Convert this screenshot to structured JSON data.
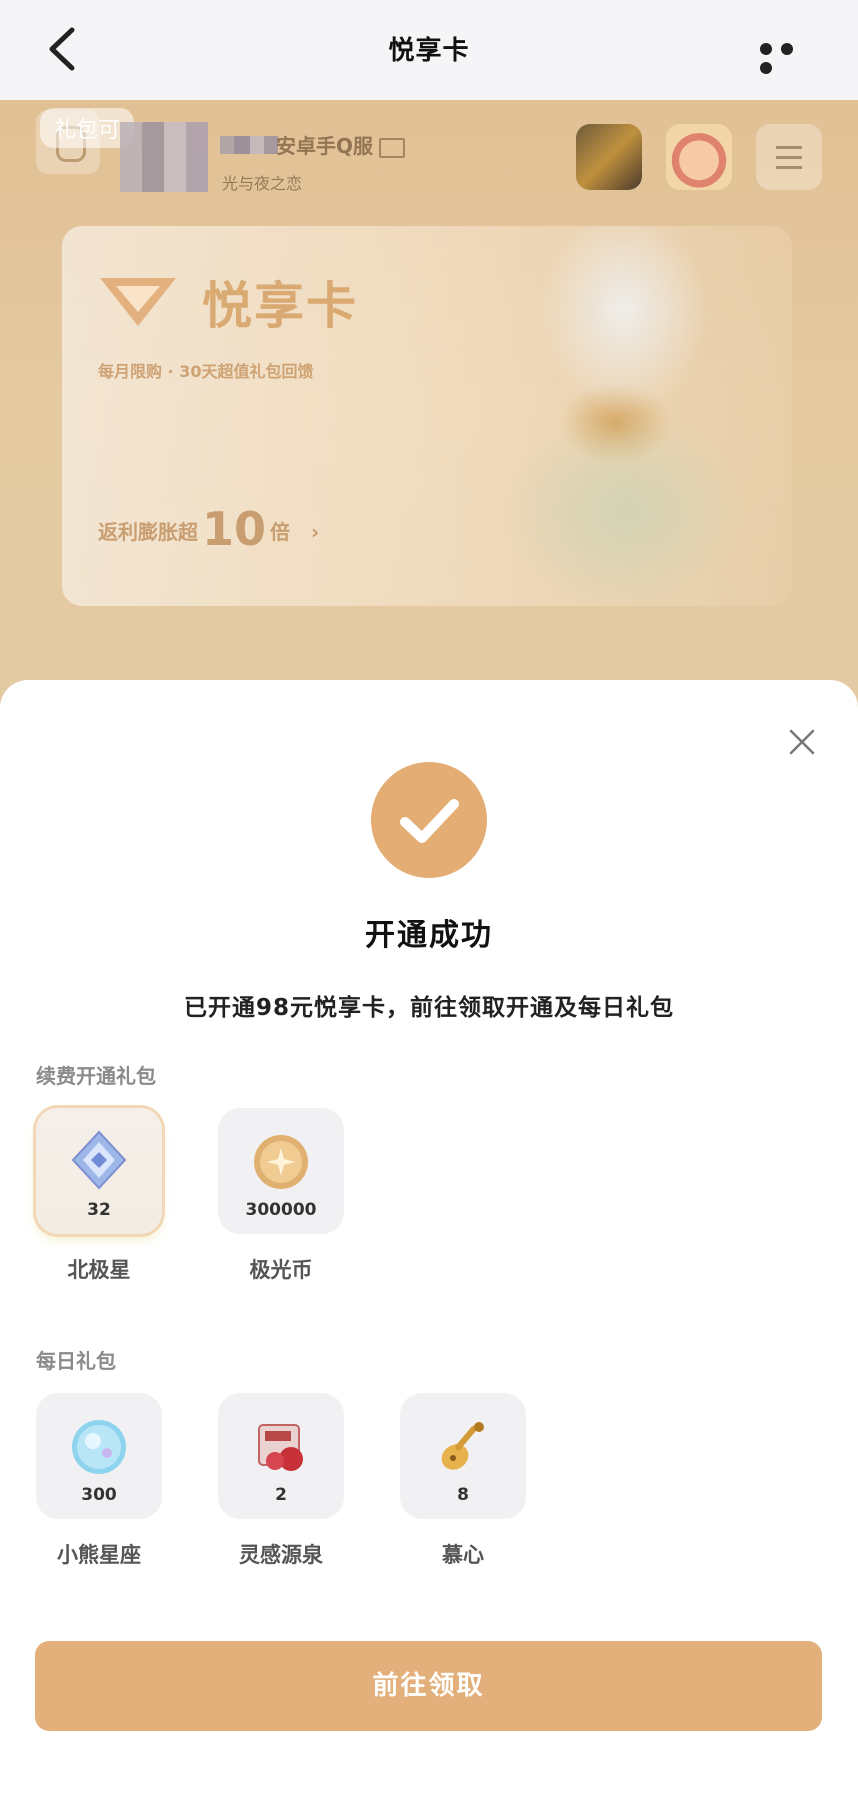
{
  "nav": {
    "title": "悦享卡"
  },
  "background": {
    "gift_tag": "礼包可",
    "server_name": "安卓手Q服",
    "game_name": "光与夜之恋",
    "card": {
      "title": "悦享卡",
      "subtitle": "每月限购 · 30天超值礼包回馈",
      "rebate_prefix": "返利膨胀超",
      "rebate_value": "10",
      "rebate_suffix": "倍",
      "rebate_arrow": "›"
    }
  },
  "dialog": {
    "title": "开通成功",
    "description": "已开通98元悦享卡，前往领取开通及每日礼包",
    "renewal_section": {
      "label": "续费开通礼包",
      "items": [
        {
          "name": "北极星",
          "qty": "32",
          "icon": "crystal-diamond-icon"
        },
        {
          "name": "极光币",
          "qty": "300000",
          "icon": "gold-coin-icon"
        }
      ]
    },
    "daily_section": {
      "label": "每日礼包",
      "items": [
        {
          "name": "小熊星座",
          "qty": "300",
          "icon": "blue-orb-icon"
        },
        {
          "name": "灵感源泉",
          "qty": "2",
          "icon": "gift-box-icon"
        },
        {
          "name": "慕心",
          "qty": "8",
          "icon": "golden-lute-icon"
        }
      ]
    },
    "claim_button": "前往领取"
  },
  "colors": {
    "accent": "#e3ad74",
    "button": "#e3b07b",
    "tile_bg": "#f1f1f3"
  }
}
